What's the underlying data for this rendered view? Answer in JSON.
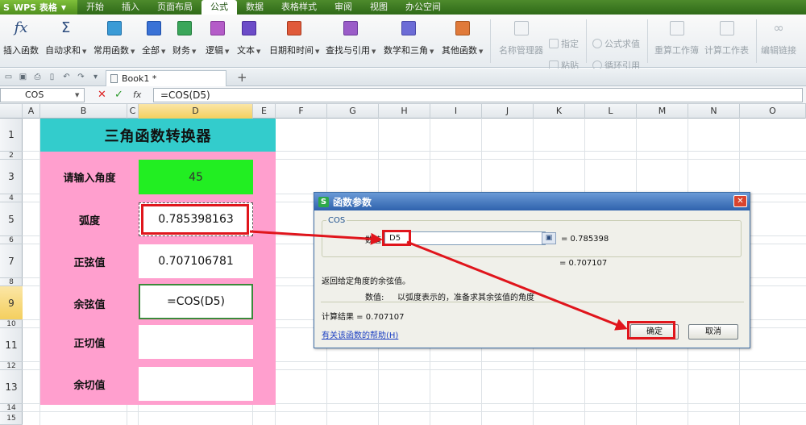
{
  "menubar": {
    "app_title": "WPS 表格",
    "tabs": [
      "开始",
      "插入",
      "页面布局",
      "公式",
      "数据",
      "表格样式",
      "审阅",
      "视图",
      "办公空间"
    ],
    "active_tab": "公式"
  },
  "ribbon": {
    "buttons": [
      {
        "label": "插入函数",
        "icon": "fx-icon"
      },
      {
        "label": "自动求和",
        "icon": "sigma-icon"
      },
      {
        "label": "常用函数",
        "icon": "book-icon"
      },
      {
        "label": "全部",
        "icon": "book-icon"
      },
      {
        "label": "财务",
        "icon": "book-icon"
      },
      {
        "label": "逻辑",
        "icon": "book-icon"
      },
      {
        "label": "文本",
        "icon": "book-icon"
      },
      {
        "label": "日期和时间",
        "icon": "book-icon"
      },
      {
        "label": "查找与引用",
        "icon": "book-icon"
      },
      {
        "label": "数学和三角",
        "icon": "book-icon"
      },
      {
        "label": "其他函数",
        "icon": "book-icon"
      },
      {
        "label": "名称管理器",
        "icon": "name-manager-icon"
      },
      {
        "label": "重算工作簿",
        "icon": "recalc-workbook-icon"
      },
      {
        "label": "计算工作表",
        "icon": "calc-sheet-icon"
      },
      {
        "label": "编辑链接",
        "icon": "link-icon"
      }
    ],
    "small": {
      "assign": "指定",
      "paste": "粘贴",
      "formula_eval": "公式求值",
      "circular_ref": "循环引用"
    }
  },
  "docbar": {
    "tab_label": "Book1 *",
    "new_tab": "+"
  },
  "formula_bar": {
    "name_box": "COS",
    "fx": "fx",
    "formula": "=COS(D5)"
  },
  "grid": {
    "columns": [
      "A",
      "B",
      "C",
      "D",
      "E",
      "F",
      "G",
      "H",
      "I",
      "J",
      "K",
      "L",
      "M",
      "N",
      "O"
    ],
    "rows": [
      "1",
      "2",
      "3",
      "4",
      "5",
      "6",
      "7",
      "8",
      "9",
      "10",
      "11",
      "12",
      "13",
      "14",
      "15"
    ]
  },
  "converter": {
    "title": "三角函数转换器",
    "labels": {
      "angle": "请输入角度",
      "radian": "弧度",
      "sine": "正弦值",
      "cosine": "余弦值",
      "tangent": "正切值",
      "cotangent": "余切值"
    },
    "values": {
      "angle": "45",
      "radian": "0.785398163",
      "sine": "0.707106781",
      "cosine": "=COS(D5)",
      "tangent": "",
      "cotangent": ""
    }
  },
  "dialog": {
    "title": "函数参数",
    "function_name": "COS",
    "param_label": "数值",
    "param_value": "D5",
    "param_result": "= 0.785398",
    "result_line": "= 0.707107",
    "description": "返回给定角度的余弦值。",
    "param_desc_label": "数值:",
    "param_desc": "以弧度表示的，准备求其余弦值的角度",
    "calc_result_label": "计算结果 = 0.707107",
    "help_link": "有关该函数的帮助(H)",
    "ok_label": "确定",
    "cancel_label": "取消"
  },
  "colors": {
    "title_bg": "#33cccc",
    "card_bg": "#ff9fce",
    "angle_bg": "#22ee22",
    "highlight_red": "#e0151c"
  }
}
